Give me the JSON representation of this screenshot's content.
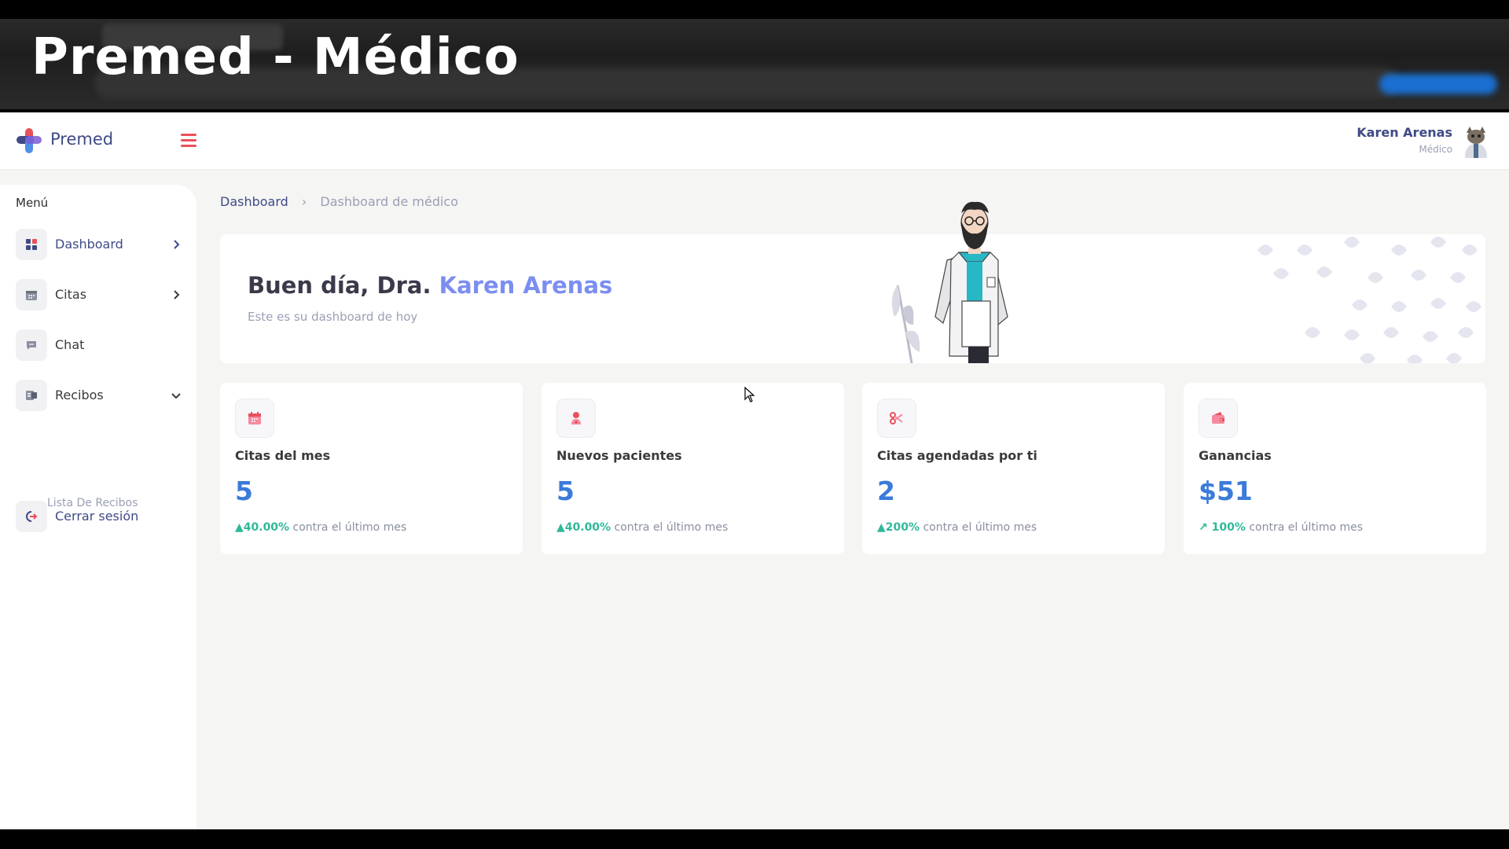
{
  "video_title": "Premed - Médico",
  "navbar": {
    "brand": "Premed",
    "user_name": "Karen Arenas",
    "user_role": "Médico",
    "hamburger_icon": "menu-icon"
  },
  "sidebar": {
    "menu_title": "Menú",
    "items": [
      {
        "label": "Dashboard",
        "icon": "dashboard-icon",
        "chevron": "right"
      },
      {
        "label": "Citas",
        "icon": "calendar-icon",
        "chevron": "right"
      },
      {
        "label": "Chat",
        "icon": "chat-icon",
        "chevron": ""
      },
      {
        "label": "Recibos",
        "icon": "receipt-icon",
        "chevron": "down"
      }
    ],
    "sub_item": "Lista De Recibos",
    "logout": "Cerrar sesión"
  },
  "breadcrumb": {
    "root": "Dashboard",
    "current": "Dashboard de médico"
  },
  "welcome": {
    "greeting": "Buen día, Dra.",
    "name": "Karen Arenas",
    "subtitle": "Este es su dashboard de hoy"
  },
  "stats": [
    {
      "title": "Citas del mes",
      "value": "5",
      "change": "▲40.00%",
      "suffix": "contra el último mes",
      "icon": "calendar-icon"
    },
    {
      "title": "Nuevos pacientes",
      "value": "5",
      "change": "▲40.00%",
      "suffix": "contra el último mes",
      "icon": "patient-add-icon"
    },
    {
      "title": "Citas agendadas por ti",
      "value": "2",
      "change": "▲200%",
      "suffix": "contra el último mes",
      "icon": "scissors-icon"
    },
    {
      "title": "Ganancias",
      "value": "$51",
      "change": "↗ 100%",
      "suffix": "contra el último mes",
      "icon": "wallet-icon"
    }
  ],
  "colors": {
    "accent": "#3f4a86",
    "highlight": "#7b8ef0",
    "value": "#3b7bd9",
    "positive": "#2fb89a",
    "icon_red": "#e8505b"
  }
}
